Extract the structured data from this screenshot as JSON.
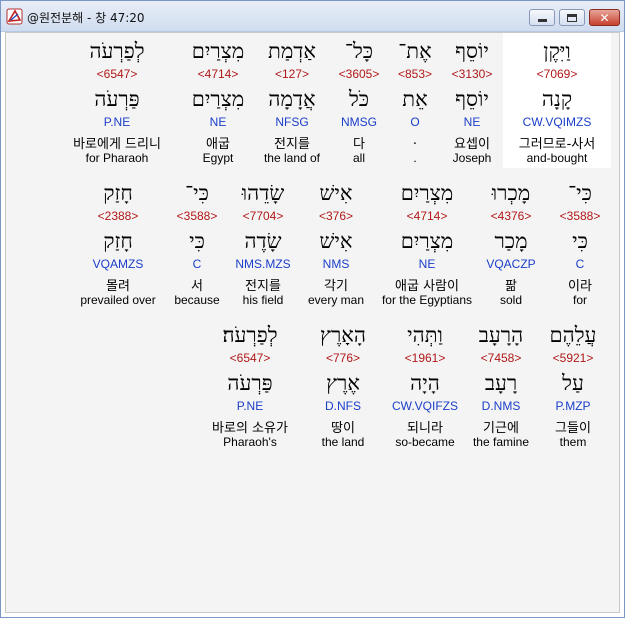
{
  "window": {
    "title": "@원전분해 - 창 47:20"
  },
  "rows": [
    [
      {
        "heb": "וַיִּקֶן",
        "strong": "<7069>",
        "lemma": "קָנָה",
        "morph": "CW.VQIMZS",
        "kor": "그러므로-사서",
        "eng": "and-bought",
        "selected": true
      },
      {
        "heb": "יוֹסֵף",
        "strong": "<3130>",
        "lemma": "יוֹסֵף",
        "morph": "NE",
        "kor": "요셉이",
        "eng": "Joseph"
      },
      {
        "heb": "אֶת־",
        "strong": "<853>",
        "lemma": "אֵת",
        "morph": "O",
        "kor": ".",
        "eng": "."
      },
      {
        "heb": "כָּל־",
        "strong": "<3605>",
        "lemma": "כֹּל",
        "morph": "NMSG",
        "kor": "다",
        "eng": "all"
      },
      {
        "heb": "אַדְמַת",
        "strong": "<127>",
        "lemma": "אֲדָמָה",
        "morph": "NFSG",
        "kor": "전지를",
        "eng": "the land of"
      },
      {
        "heb": "מִצְרַיִם",
        "strong": "<4714>",
        "lemma": "מִצְרַיִם",
        "morph": "NE",
        "kor": "애굽",
        "eng": "Egypt"
      },
      {
        "heb": "לְפַרְעֹה",
        "strong": "<6547>",
        "lemma": "פַּרְעֹה",
        "morph": "P.NE",
        "kor": "바로에게 드리니",
        "eng": "for Pharaoh"
      }
    ],
    [
      {
        "heb": "כִּי־",
        "strong": "<3588>",
        "lemma": "כִּי",
        "morph": "C",
        "kor": "이라",
        "eng": "for"
      },
      {
        "heb": "מָכְרוּ",
        "strong": "<4376>",
        "lemma": "מָכַר",
        "morph": "VQACZP",
        "kor": "팖",
        "eng": "sold"
      },
      {
        "heb": "מִצְרַיִם",
        "strong": "<4714>",
        "lemma": "מִצְרַיִם",
        "morph": "NE",
        "kor": "애굽 사람이",
        "eng": "for the Egyptians"
      },
      {
        "heb": "אִישׁ",
        "strong": "<376>",
        "lemma": "אִישׁ",
        "morph": "NMS",
        "kor": "각기",
        "eng": "every man"
      },
      {
        "heb": "שָׂדֵהוּ",
        "strong": "<7704>",
        "lemma": "שָׂדֶה",
        "morph": "NMS.MZS",
        "kor": "전지를",
        "eng": "his field"
      },
      {
        "heb": "כִּי־",
        "strong": "<3588>",
        "lemma": "כִּי",
        "morph": "C",
        "kor": "서",
        "eng": "because"
      },
      {
        "heb": "חָזַק",
        "strong": "<2388>",
        "lemma": "חָזַק",
        "morph": "VQAMZS",
        "kor": "몰려",
        "eng": "prevailed over"
      }
    ],
    [
      {
        "heb": "עֲלֵהֶם",
        "strong": "<5921>",
        "lemma": "עַל",
        "morph": "P.MZP",
        "kor": "그들이",
        "eng": "them"
      },
      {
        "heb": "הָרָעָב",
        "strong": "<7458>",
        "lemma": "רָעָב",
        "morph": "D.NMS",
        "kor": "기근에",
        "eng": "the famine"
      },
      {
        "heb": "וַתְּהִי",
        "strong": "<1961>",
        "lemma": "הָיָה",
        "morph": "CW.VQIFZS",
        "kor": "되니라",
        "eng": "so-became"
      },
      {
        "heb": "הָאָרֶץ",
        "strong": "<776>",
        "lemma": "אֶרֶץ",
        "morph": "D.NFS",
        "kor": "땅이",
        "eng": "the land"
      },
      {
        "heb": "לְפַרְעֹה׃",
        "strong": "<6547>",
        "lemma": "פַּרְעֹה",
        "morph": "P.NE",
        "kor": "바로의 소유가",
        "eng": "Pharaoh's"
      }
    ]
  ]
}
